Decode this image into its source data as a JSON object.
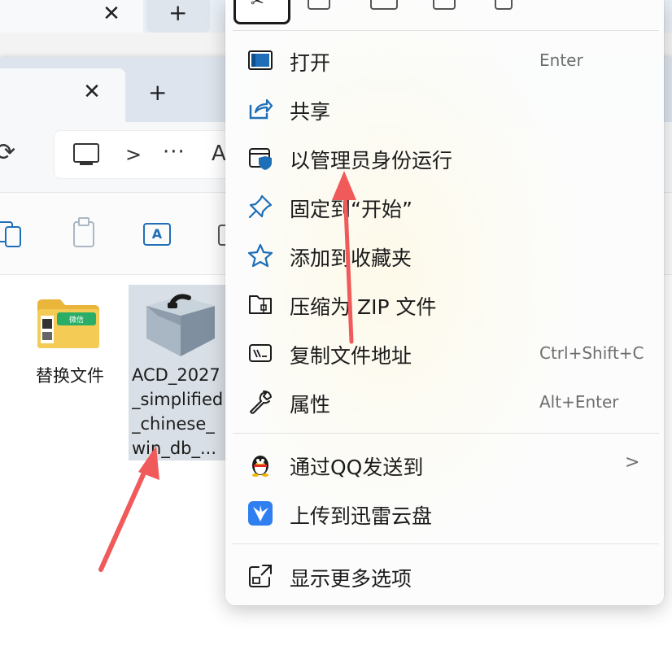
{
  "explorer": {
    "tab_close_symbol": "✕",
    "tab_new_symbol": "+",
    "address": {
      "separator": ">",
      "more": "···",
      "truncated_text": "A"
    },
    "files": [
      {
        "name": "替换文件",
        "icon": "wechat-folder-icon"
      },
      {
        "name": "ACD_2027\n_simplified\n_chinese_\nwin_db_...",
        "icon": "installer-box-icon",
        "selected": true
      }
    ]
  },
  "context_menu": {
    "items": [
      {
        "label": "打开",
        "shortcut": "Enter",
        "icon": "open-window-icon"
      },
      {
        "label": "共享",
        "shortcut": "",
        "icon": "share-icon"
      },
      {
        "label": "以管理员身份运行",
        "shortcut": "",
        "icon": "run-as-admin-shield-icon"
      },
      {
        "label": "固定到“开始”",
        "shortcut": "",
        "icon": "pin-icon"
      },
      {
        "label": "添加到收藏夹",
        "shortcut": "",
        "icon": "star-icon"
      },
      {
        "label": "压缩为 ZIP 文件",
        "shortcut": "",
        "icon": "zip-folder-icon"
      },
      {
        "label": "复制文件地址",
        "shortcut": "Ctrl+Shift+C",
        "icon": "copy-path-icon"
      },
      {
        "label": "属性",
        "shortcut": "Alt+Enter",
        "icon": "wrench-icon"
      }
    ],
    "group2": [
      {
        "label": "通过QQ发送到",
        "submenu_symbol": ">",
        "icon": "qq-penguin-icon"
      },
      {
        "label": "上传到迅雷云盘",
        "icon": "xunlei-bird-icon"
      }
    ],
    "footer": {
      "label": "显示更多选项",
      "icon": "show-more-options-icon"
    }
  },
  "colors": {
    "accent_blue": "#1e6fb8",
    "annotation_red": "#f05a5a",
    "selection": "#d9dfe6"
  }
}
